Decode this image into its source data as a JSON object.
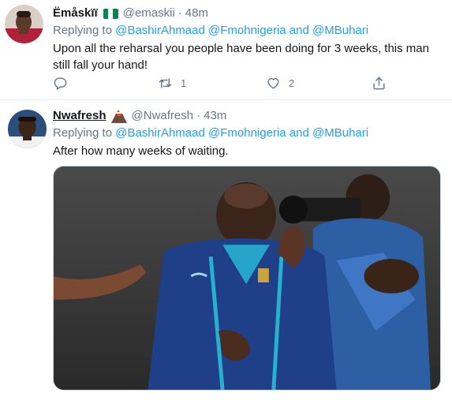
{
  "tweets": [
    {
      "name": "Ëmåskïï",
      "handle": "@emaskii",
      "separator": "·",
      "time": "48m",
      "replying_to_label": "Replying to",
      "mentions": [
        "@BashirAhmaad",
        "@Fmohnigeria",
        "@MBuhari"
      ],
      "mention_joiner": "and",
      "text": "Upon all the reharsal you people have been doing for 3 weeks, this man still fall your hand!",
      "actions": {
        "reply_icon": "reply-icon",
        "retweet_icon": "retweet-icon",
        "retweet_count": "1",
        "like_icon": "heart-icon",
        "like_count": "2",
        "share_icon": "share-icon"
      }
    },
    {
      "name": "Nwafresh",
      "handle": "@Nwafresh",
      "separator": "·",
      "time": "43m",
      "replying_to_label": "Replying to",
      "mentions": [
        "@BashirAhmaad",
        "@Fmohnigeria",
        "@MBuhari"
      ],
      "mention_joiner": "and",
      "text": "After how many weeks of waiting."
    }
  ],
  "colors": {
    "link": "#1da1f2",
    "secondary_text": "#657786",
    "primary_text": "#14171a",
    "divider": "#e6ecf0"
  }
}
